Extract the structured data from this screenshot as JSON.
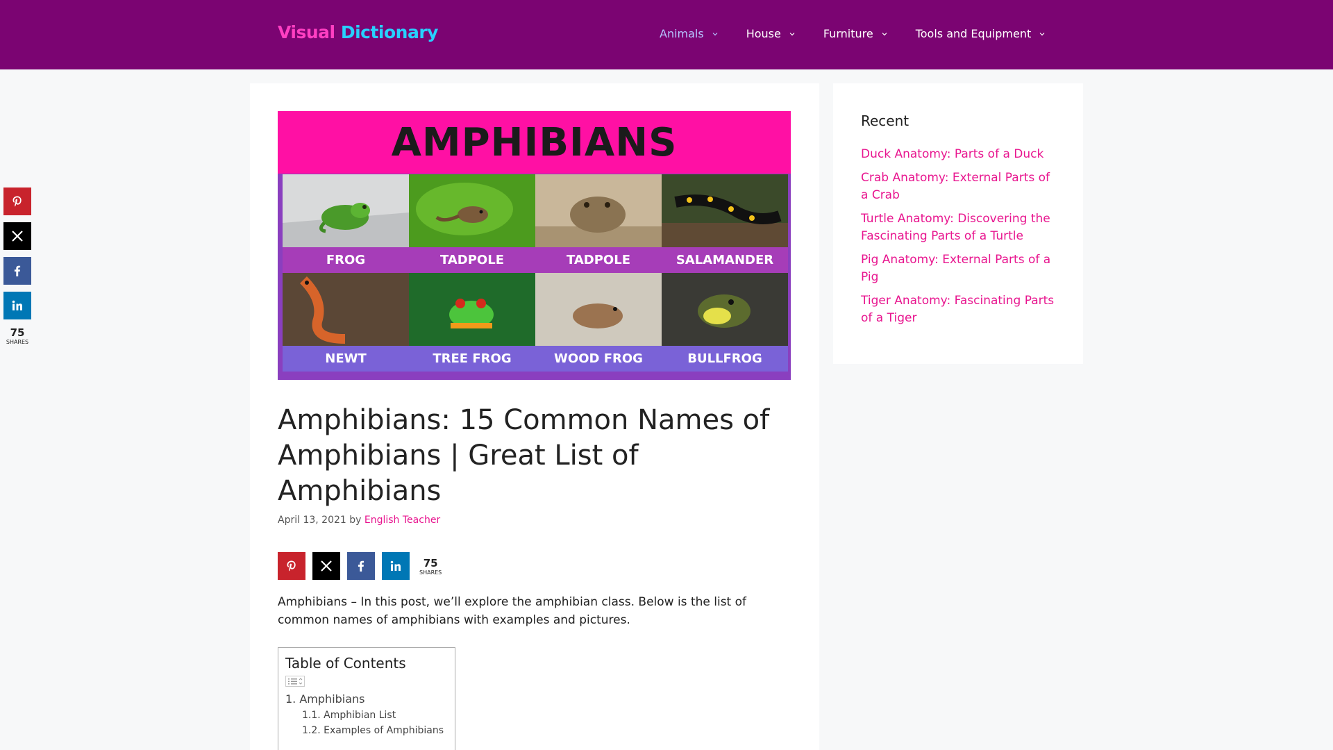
{
  "header": {
    "logo_word1": "Visual",
    "logo_word2": "Dictionary",
    "nav": [
      {
        "label": "Animals",
        "active": true
      },
      {
        "label": "House",
        "active": false
      },
      {
        "label": "Furniture",
        "active": false
      },
      {
        "label": "Tools and Equipment",
        "active": false
      }
    ]
  },
  "colors": {
    "header_bg": "#7b0472",
    "accent_pink": "#e8168f",
    "hero_banner": "#ff10a4",
    "pinterest": "#c8232c",
    "x": "#000000",
    "facebook": "#3b5998",
    "linkedin": "#0077b5"
  },
  "share": {
    "count": "75",
    "label": "SHARES",
    "icons": [
      "pinterest-icon",
      "x-icon",
      "facebook-icon",
      "linkedin-icon"
    ]
  },
  "hero": {
    "title": "AMPHIBIANS",
    "cells": [
      {
        "label": "FROG"
      },
      {
        "label": "TADPOLE"
      },
      {
        "label": "TADPOLE"
      },
      {
        "label": "SALAMANDER"
      },
      {
        "label": "NEWT"
      },
      {
        "label": "TREE FROG"
      },
      {
        "label": "WOOD FROG"
      },
      {
        "label": "BULLFROG"
      }
    ]
  },
  "post": {
    "title": "Amphibians: 15 Common Names of Amphibians | Great List of Amphibians",
    "date": "April 13, 2021",
    "by": "by",
    "author": "English Teacher",
    "intro": "Amphibians – In this post, we’ll explore the amphibian class. Below is the list of common names of amphibians with examples and pictures."
  },
  "toc": {
    "title": "Table of Contents",
    "items": [
      {
        "num": "1.",
        "label": "Amphibians"
      },
      {
        "num": "1.1.",
        "label": "Amphibian List"
      },
      {
        "num": "1.2.",
        "label": "Examples of Amphibians"
      }
    ]
  },
  "sidebar": {
    "title": "Recent",
    "links": [
      "Duck Anatomy: Parts of a Duck",
      "Crab Anatomy: External Parts of a Crab",
      "Turtle Anatomy: Discovering the Fascinating Parts of a Turtle",
      "Pig Anatomy: External Parts of a Pig",
      "Tiger Anatomy: Fascinating Parts of a Tiger"
    ]
  }
}
